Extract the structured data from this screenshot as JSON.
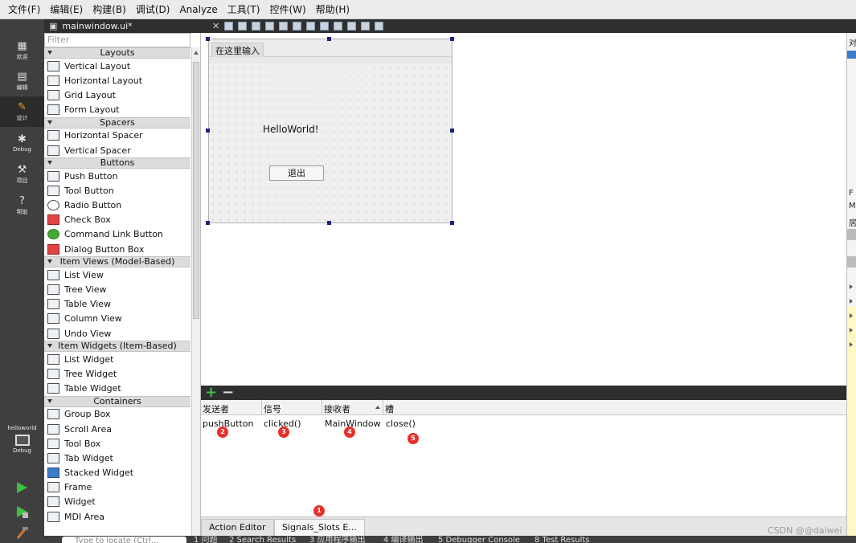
{
  "menubar": [
    "文件(F)",
    "编辑(E)",
    "构建(B)",
    "调试(D)",
    "Analyze",
    "工具(T)",
    "控件(W)",
    "帮助(H)"
  ],
  "modes": {
    "welcome": "欢迎",
    "edit": "编辑",
    "design": "设计",
    "debug": "Debug",
    "projects": "项目",
    "help": "帮助"
  },
  "kit": {
    "project": "helloworld",
    "mode": "Debug"
  },
  "editor": {
    "filename": "mainwindow.ui*"
  },
  "widgetbox": {
    "filter_placeholder": "Filter",
    "categories": [
      {
        "name": "Layouts",
        "items": [
          "Vertical Layout",
          "Horizontal Layout",
          "Grid Layout",
          "Form Layout"
        ]
      },
      {
        "name": "Spacers",
        "items": [
          "Horizontal Spacer",
          "Vertical Spacer"
        ]
      },
      {
        "name": "Buttons",
        "items": [
          "Push Button",
          "Tool Button",
          "Radio Button",
          "Check Box",
          "Command Link Button",
          "Dialog Button Box"
        ]
      },
      {
        "name": "Item Views (Model-Based)",
        "items": [
          "List View",
          "Tree View",
          "Table View",
          "Column View",
          "Undo View"
        ]
      },
      {
        "name": "Item Widgets (Item-Based)",
        "items": [
          "List Widget",
          "Tree Widget",
          "Table Widget"
        ]
      },
      {
        "name": "Containers",
        "items": [
          "Group Box",
          "Scroll Area",
          "Tool Box",
          "Tab Widget",
          "Stacked Widget",
          "Frame",
          "Widget",
          "MDI Area"
        ]
      }
    ]
  },
  "form": {
    "menu_placeholder": "在这里输入",
    "label_text": "HelloWorld!",
    "button_text": "退出"
  },
  "signals": {
    "headers": {
      "sender": "发送者",
      "signal": "信号",
      "receiver": "接收者",
      "slot": "槽"
    },
    "row": {
      "sender": "pushButton",
      "signal": "clicked()",
      "receiver": "MainWindow",
      "slot": "close()"
    },
    "badges": [
      "1",
      "2",
      "3",
      "4",
      "5"
    ]
  },
  "tabs": {
    "action_editor": "Action Editor",
    "signals_slots": "Signals_Slots E..."
  },
  "bottombar": {
    "locate_placeholder": "Type to locate (Ctrl...",
    "panes": [
      "1 问题",
      "2 Search Results",
      "3 应用程序输出",
      "4 编译输出",
      "5 Debugger Console",
      "8 Test Results"
    ]
  },
  "rightpanel": {
    "t1": "对",
    "t2": "F",
    "t3": "M",
    "t4": "居"
  },
  "watermark": "CSDN @@daiwei"
}
